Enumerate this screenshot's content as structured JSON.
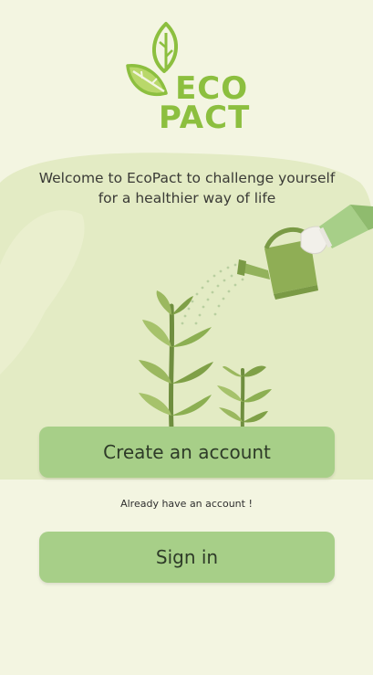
{
  "logo": {
    "line1": "ECO",
    "line2": "PACT"
  },
  "welcome_text": "Welcome to EcoPact to challenge yourself  for a healthier way of life",
  "buttons": {
    "create_account": "Create an account",
    "sign_in": "Sign in"
  },
  "already_text": "Already have an account !",
  "colors": {
    "background": "#f3f5e1",
    "accent": "#a7cf88",
    "logo_green": "#8cbf3f"
  }
}
